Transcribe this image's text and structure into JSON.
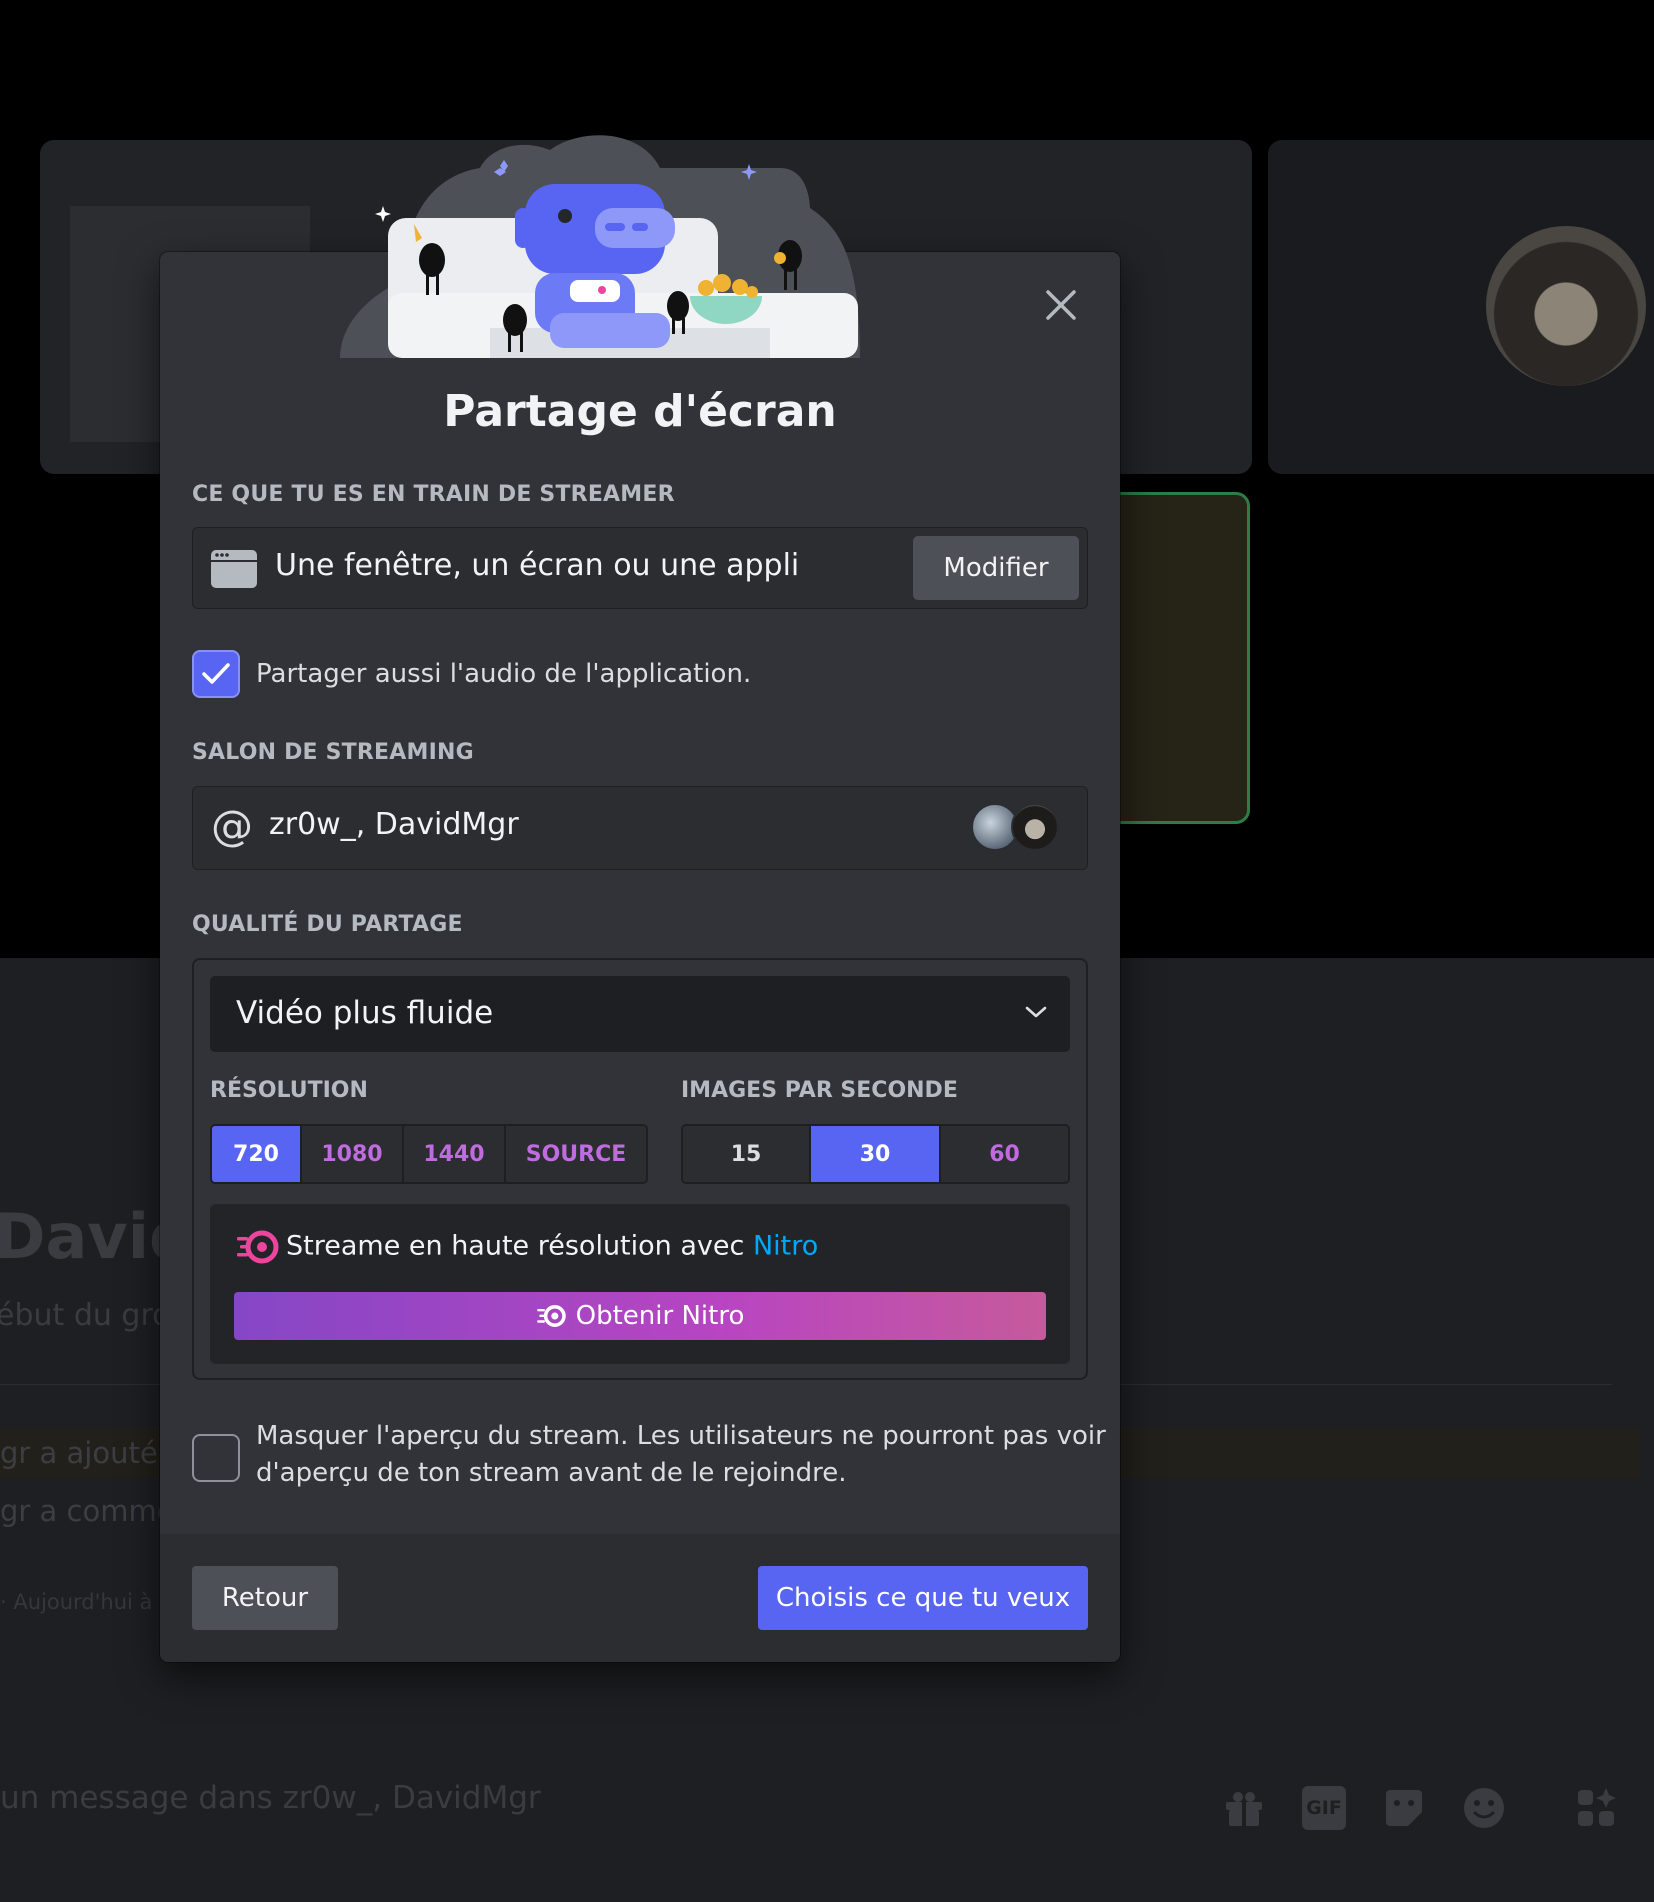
{
  "background": {
    "chat_name": "David",
    "chat_subtitle": "ébut du grou",
    "system_msg_1": "gr a ajouté l",
    "system_msg_2": "gr a comme",
    "timestamp": "· Aujourd'hui à",
    "message_placeholder": "un message dans zr0w_, DavidMgr",
    "toolbar_icons": [
      "gift-icon",
      "gif-icon",
      "sticker-icon",
      "emoji-icon",
      "apps-icon"
    ],
    "gif_label": "GIF"
  },
  "modal": {
    "title": "Partage d'écran",
    "streaming_section_label": "CE QUE TU ES EN TRAIN DE STREAMER",
    "source_text": "Une fenêtre, un écran ou une appli",
    "modify_label": "Modifier",
    "share_audio_label": "Partager aussi l'audio de l'application.",
    "share_audio_checked": true,
    "channel_section_label": "SALON DE STREAMING",
    "channel_at": "@",
    "channel_name": "zr0w_, DavidMgr",
    "quality_section_label": "QUALITÉ DU PARTAGE",
    "quality_preset": "Vidéo plus fluide",
    "resolution_label": "RÉSOLUTION",
    "resolution_options": [
      "720",
      "1080",
      "1440",
      "SOURCE"
    ],
    "resolution_selected": "720",
    "fps_label": "IMAGES PAR SECONDE",
    "fps_options": [
      "15",
      "30",
      "60"
    ],
    "fps_selected": "30",
    "nitro_text": "Streame en haute résolution avec",
    "nitro_word": "Nitro",
    "nitro_button": "Obtenir Nitro",
    "hide_preview_line1": "Masquer l'aperçu du stream. Les utilisateurs ne pourront pas voir",
    "hide_preview_line2": "d'aperçu de ton stream avant de le rejoindre.",
    "hide_preview_checked": false,
    "back_label": "Retour",
    "primary_label": "Choisis ce que tu veux"
  },
  "colors": {
    "accent": "#5865f2",
    "nitro_link": "#00a8fc",
    "nitro_text": "#c06be0",
    "modal_bg": "#313338"
  }
}
